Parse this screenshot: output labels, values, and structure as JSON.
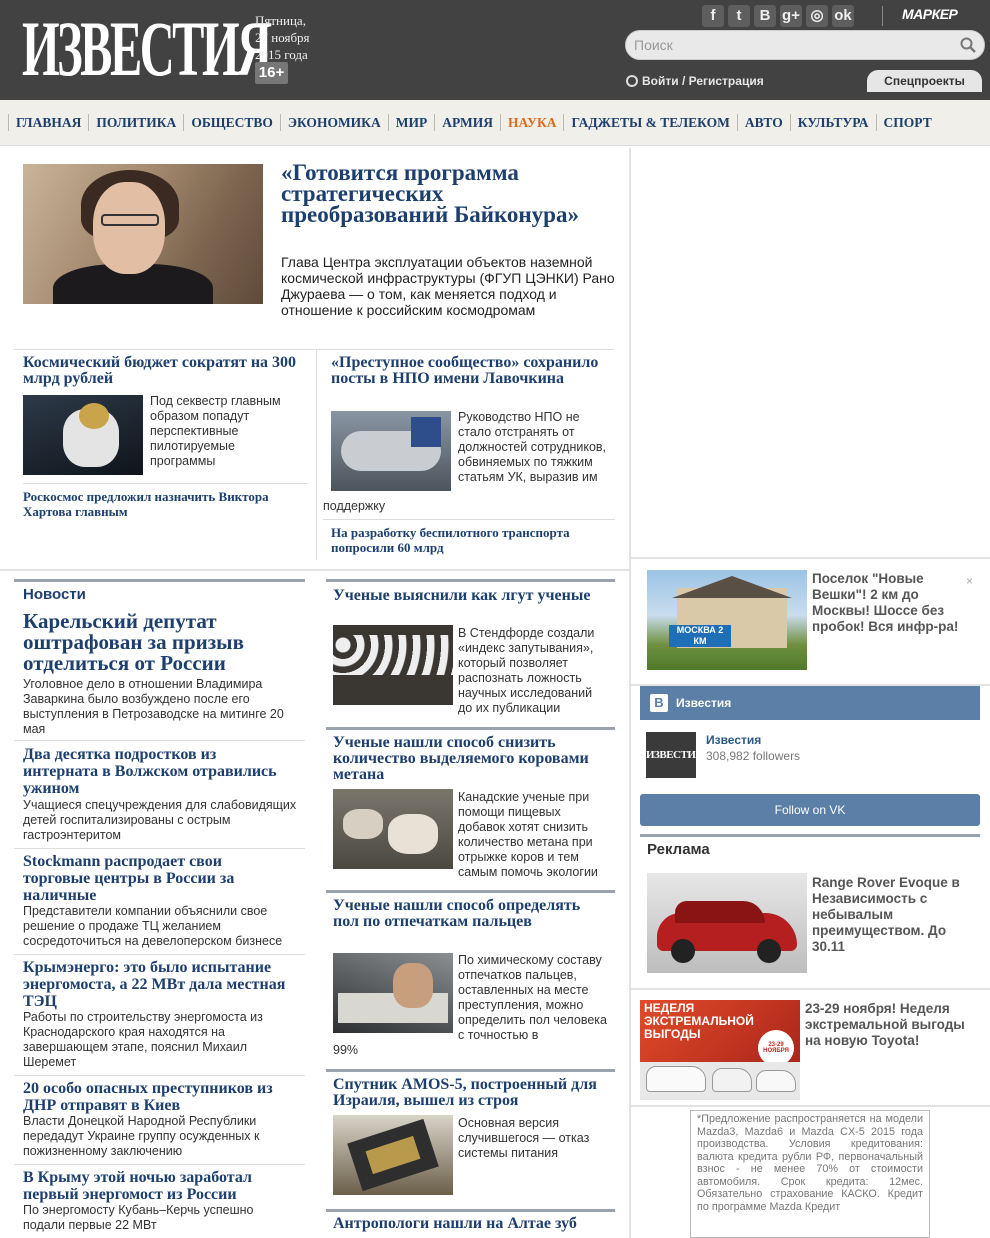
{
  "header": {
    "logo": "ИЗВЕСТИЯ",
    "date_day": "Пятница,",
    "date_date": "27 ноября",
    "date_year": "2015 года",
    "age": "16+",
    "social": [
      "f",
      "t",
      "B",
      "g+",
      "◎",
      "ok"
    ],
    "marker": "МАРКЕР",
    "search_placeholder": "Поиск",
    "login": "Войти / Регистрация",
    "special": "Спецпроекты"
  },
  "nav": {
    "items": [
      "ГЛАВНАЯ",
      "ПОЛИТИКА",
      "ОБЩЕСТВО",
      "ЭКОНОМИКА",
      "МИР",
      "АРМИЯ",
      "НАУКА",
      "ГАДЖЕТЫ & ТЕЛЕКОМ",
      "АВТО",
      "КУЛЬТУРА",
      "СПОРТ"
    ],
    "active": "НАУКА"
  },
  "feature": {
    "title": "«Готовится программа стратегических преобразований Байконура»",
    "lead": "Глава Центра эксплуатации объектов наземной космической инфраструктуры (ФГУП ЦЭНКИ) Рано Джураева — о том, как меняется подход и отношение к российским космодромам"
  },
  "science_top": [
    {
      "title": "Космический бюджет сократят на 300 млрд рублей",
      "text": "Под секвестр главным образом попадут перспективные пилотируемые программы",
      "link": "Роскосмос предложил назначить Виктора Хартова главным"
    },
    {
      "title": "«Преступное сообщество» сохранило посты в НПО имени Лавочкина",
      "text": "Руководство НПО не стало отстранять от должностей сотрудников, обвиняемых по тяжким статьям УК, выразив им",
      "text_tail": "поддержку",
      "link": "На разработку беспилотного транспорта попросили 60 млрд"
    }
  ],
  "news": {
    "heading": "Новости",
    "lead_title": "Карельский депутат оштрафован за призыв отделиться от России",
    "lead_text": "Уголовное дело в отношении Владимира Заваркина было возбуждено после его выступления в Петрозаводске на митинге 20 мая",
    "items": [
      {
        "title": "Два десятка подростков из интерната в Волжском отравились ужином",
        "text": "Учащиеся спецучреждения для слабовидящих детей госпитализированы с острым гастроэнтеритом"
      },
      {
        "title": "Stockmann распродает свои торговые центры в России за наличные",
        "text": "Представители компании объяснили свое решение о продаже ТЦ желанием сосредоточиться на девелоперском бизнесе"
      },
      {
        "title": "Крымэнерго: это было испытание энергомоста, а 22 МВт дала местная ТЭЦ",
        "text": "Работы по строительству энергомоста из Краснодарского края находятся на завершающем этапе, пояснил Михаил Шеремет"
      },
      {
        "title": "20 особо опасных преступников из ДНР отправят в Киев",
        "text": "Власти Донецкой Народной Республики передадут Украине группу осужденных к пожизненному заключению"
      },
      {
        "title": "В Крыму этой ночью заработал первый энергомост из России",
        "text": "По энергомосту Кубань–Керчь успешно подали первые 22 МВт"
      }
    ]
  },
  "science_list": [
    {
      "title": "Ученые выяснили как лгут ученые",
      "text": "В Стендфорде создали «индекс запутывания», который позволяет распознать ложность научных исследований до их публикации"
    },
    {
      "title": "Ученые нашли способ снизить количество выделяемого коровами метана",
      "text": "Канадские ученые при помощи пищевых добавок хотят снизить количество метана при отрыжке коров и тем самым помочь экологии"
    },
    {
      "title": "Ученые нашли способ определять пол по отпечаткам пальцев",
      "text": "По химическому составу отпечатков пальцев, оставленных на месте преступления, можно определить пол человека с точностью в",
      "text_tail": "99%"
    },
    {
      "title": "Спутник AMOS-5, построенный для Израиля, вышел из строя",
      "text": "Основная версия случившегося — отказ системы питания"
    },
    {
      "title": "Антропологи нашли на Алтае зуб"
    }
  ],
  "right": {
    "ad1": {
      "text": "Поселок \"Новые Вешки\"! 2 км до Москвы! Шоссе без пробок! Вся инфр-ра!",
      "sign": "МОСКВА 2 КМ"
    },
    "vk": {
      "title": "Известия",
      "name": "Известия",
      "followers": "308,982 followers",
      "follow": "Follow on VK",
      "avatar": "ИЗВЕСТИЯ"
    },
    "reklama": "Реклама",
    "ad2": {
      "text": "Range Rover Evoque в Незавиcимость с небывалым преимуществом. До 30.11"
    },
    "ad3": {
      "text": "23-29 ноября! Неделя экстремальной выгоды на новую Toyota!",
      "banner": "НЕДЕЛЯ ЭКСТРЕМАЛЬНОЙ ВЫГОДЫ",
      "badge": "23-29 НОЯБРЯ"
    },
    "disclaimer": "*Предложение распространяется на модели Mazda3, Mazda6 и Mazda CX-5 2015 года производства. Условия кредитования: валюта кредита рубли РФ, первоначальный взнос - не менее 70% от стоимости автомобиля. Срок кредита: 12мес. Обязательно страхование КАСКО. Кредит по программе Mazda Кредит"
  }
}
